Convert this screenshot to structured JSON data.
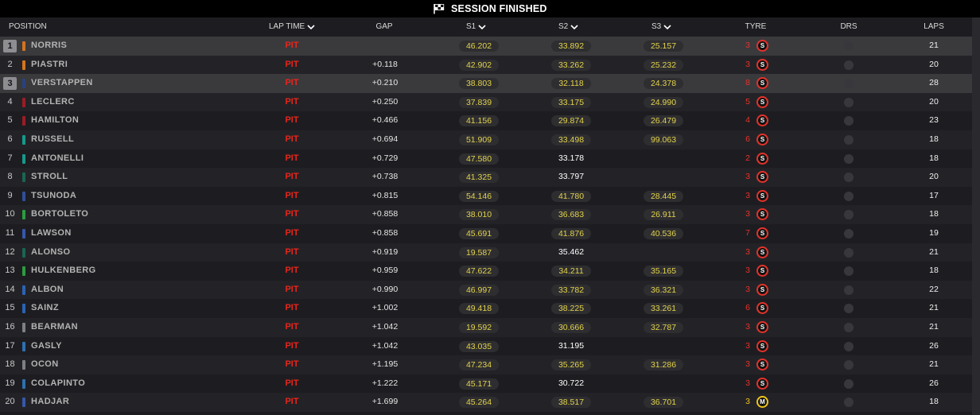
{
  "banner": {
    "title": "SESSION FINISHED",
    "icon": "checkered-flag-icon"
  },
  "columns": {
    "position": "POSITION",
    "lap_time": "LAP TIME",
    "gap": "GAP",
    "s1": "S1",
    "s2": "S2",
    "s3": "S3",
    "tyre": "TYRE",
    "drs": "DRS",
    "laps": "LAPS"
  },
  "colors": {
    "pit": "#e8251b",
    "sector_yellow": "#e3d24a",
    "sector_white": "#ffffff",
    "soft": "#e5322a",
    "medium": "#f0c419",
    "drs_off": "#38383c"
  },
  "rows": [
    {
      "position": "1",
      "driver": "NORRIS",
      "team_color": "#d4741f",
      "selected": true,
      "lap_time": "PIT",
      "gap": "",
      "s1": {
        "time": "46.202",
        "color": "#e3d24a"
      },
      "s2": {
        "time": "33.892",
        "color": "#e3d24a"
      },
      "s3": {
        "time": "25.157",
        "color": "#e3d24a"
      },
      "tyre": {
        "age": "3",
        "compound": "S",
        "color": "#e5322a"
      },
      "drs_open": false,
      "laps": "21"
    },
    {
      "position": "2",
      "driver": "PIASTRI",
      "team_color": "#d4741f",
      "selected": false,
      "lap_time": "PIT",
      "gap": "+0.118",
      "s1": {
        "time": "42.902",
        "color": "#e3d24a"
      },
      "s2": {
        "time": "33.262",
        "color": "#e3d24a"
      },
      "s3": {
        "time": "25.232",
        "color": "#e3d24a"
      },
      "tyre": {
        "age": "3",
        "compound": "S",
        "color": "#e5322a"
      },
      "drs_open": false,
      "laps": "20"
    },
    {
      "position": "3",
      "driver": "VERSTAPPEN",
      "team_color": "#28427f",
      "selected": true,
      "lap_time": "PIT",
      "gap": "+0.210",
      "s1": {
        "time": "38.803",
        "color": "#e3d24a"
      },
      "s2": {
        "time": "32.118",
        "color": "#e3d24a"
      },
      "s3": {
        "time": "24.378",
        "color": "#e3d24a"
      },
      "tyre": {
        "age": "8",
        "compound": "S",
        "color": "#e5322a"
      },
      "drs_open": false,
      "laps": "28"
    },
    {
      "position": "4",
      "driver": "LECLERC",
      "team_color": "#9b1c26",
      "selected": false,
      "lap_time": "PIT",
      "gap": "+0.250",
      "s1": {
        "time": "37.839",
        "color": "#e3d24a"
      },
      "s2": {
        "time": "33.175",
        "color": "#e3d24a"
      },
      "s3": {
        "time": "24.990",
        "color": "#e3d24a"
      },
      "tyre": {
        "age": "5",
        "compound": "S",
        "color": "#e5322a"
      },
      "drs_open": false,
      "laps": "20"
    },
    {
      "position": "5",
      "driver": "HAMILTON",
      "team_color": "#9b1c26",
      "selected": false,
      "lap_time": "PIT",
      "gap": "+0.466",
      "s1": {
        "time": "41.156",
        "color": "#e3d24a"
      },
      "s2": {
        "time": "29.874",
        "color": "#e3d24a"
      },
      "s3": {
        "time": "26.479",
        "color": "#e3d24a"
      },
      "tyre": {
        "age": "4",
        "compound": "S",
        "color": "#e5322a"
      },
      "drs_open": false,
      "laps": "23"
    },
    {
      "position": "6",
      "driver": "RUSSELL",
      "team_color": "#17998a",
      "selected": false,
      "lap_time": "PIT",
      "gap": "+0.694",
      "s1": {
        "time": "51.909",
        "color": "#e3d24a"
      },
      "s2": {
        "time": "33.498",
        "color": "#e3d24a"
      },
      "s3": {
        "time": "99.063",
        "color": "#e3d24a"
      },
      "tyre": {
        "age": "6",
        "compound": "S",
        "color": "#e5322a"
      },
      "drs_open": false,
      "laps": "18"
    },
    {
      "position": "7",
      "driver": "ANTONELLI",
      "team_color": "#17998a",
      "selected": false,
      "lap_time": "PIT",
      "gap": "+0.729",
      "s1": {
        "time": "47.580",
        "color": "#e3d24a"
      },
      "s2": {
        "time": "33.178",
        "color": "#ffffff",
        "pill": false
      },
      "s3": null,
      "tyre": {
        "age": "2",
        "compound": "S",
        "color": "#e5322a"
      },
      "drs_open": false,
      "laps": "18"
    },
    {
      "position": "8",
      "driver": "STROLL",
      "team_color": "#1b6452",
      "selected": false,
      "lap_time": "PIT",
      "gap": "+0.738",
      "s1": {
        "time": "41.325",
        "color": "#e3d24a"
      },
      "s2": {
        "time": "33.797",
        "color": "#ffffff",
        "pill": false
      },
      "s3": null,
      "tyre": {
        "age": "3",
        "compound": "S",
        "color": "#e5322a"
      },
      "drs_open": false,
      "laps": "20"
    },
    {
      "position": "9",
      "driver": "TSUNODA",
      "team_color": "#2f4f9a",
      "selected": false,
      "lap_time": "PIT",
      "gap": "+0.815",
      "s1": {
        "time": "54.146",
        "color": "#e3d24a"
      },
      "s2": {
        "time": "41.780",
        "color": "#e3d24a"
      },
      "s3": {
        "time": "28.445",
        "color": "#e3d24a"
      },
      "tyre": {
        "age": "3",
        "compound": "S",
        "color": "#e5322a"
      },
      "drs_open": false,
      "laps": "17"
    },
    {
      "position": "10",
      "driver": "BORTOLETO",
      "team_color": "#2c9c3f",
      "selected": false,
      "lap_time": "PIT",
      "gap": "+0.858",
      "s1": {
        "time": "38.010",
        "color": "#e3d24a"
      },
      "s2": {
        "time": "36.683",
        "color": "#e3d24a"
      },
      "s3": {
        "time": "26.911",
        "color": "#e3d24a"
      },
      "tyre": {
        "age": "3",
        "compound": "S",
        "color": "#e5322a"
      },
      "drs_open": false,
      "laps": "18"
    },
    {
      "position": "11",
      "driver": "LAWSON",
      "team_color": "#3658a8",
      "selected": false,
      "lap_time": "PIT",
      "gap": "+0.858",
      "s1": {
        "time": "45.691",
        "color": "#e3d24a"
      },
      "s2": {
        "time": "41.876",
        "color": "#e3d24a"
      },
      "s3": {
        "time": "40.536",
        "color": "#e3d24a"
      },
      "tyre": {
        "age": "7",
        "compound": "S",
        "color": "#e5322a"
      },
      "drs_open": false,
      "laps": "19"
    },
    {
      "position": "12",
      "driver": "ALONSO",
      "team_color": "#1b6452",
      "selected": false,
      "lap_time": "PIT",
      "gap": "+0.919",
      "s1": {
        "time": "19.587",
        "color": "#e3d24a"
      },
      "s2": {
        "time": "35.462",
        "color": "#ffffff",
        "pill": false
      },
      "s3": null,
      "tyre": {
        "age": "3",
        "compound": "S",
        "color": "#e5322a"
      },
      "drs_open": false,
      "laps": "21"
    },
    {
      "position": "13",
      "driver": "HULKENBERG",
      "team_color": "#2c9c3f",
      "selected": false,
      "lap_time": "PIT",
      "gap": "+0.959",
      "s1": {
        "time": "47.622",
        "color": "#e3d24a"
      },
      "s2": {
        "time": "34.211",
        "color": "#e3d24a"
      },
      "s3": {
        "time": "35.165",
        "color": "#e3d24a"
      },
      "tyre": {
        "age": "3",
        "compound": "S",
        "color": "#e5322a"
      },
      "drs_open": false,
      "laps": "18"
    },
    {
      "position": "14",
      "driver": "ALBON",
      "team_color": "#2b63b5",
      "selected": false,
      "lap_time": "PIT",
      "gap": "+0.990",
      "s1": {
        "time": "46.997",
        "color": "#e3d24a"
      },
      "s2": {
        "time": "33.782",
        "color": "#e3d24a"
      },
      "s3": {
        "time": "36.321",
        "color": "#e3d24a"
      },
      "tyre": {
        "age": "3",
        "compound": "S",
        "color": "#e5322a"
      },
      "drs_open": false,
      "laps": "22"
    },
    {
      "position": "15",
      "driver": "SAINZ",
      "team_color": "#2b63b5",
      "selected": false,
      "lap_time": "PIT",
      "gap": "+1.002",
      "s1": {
        "time": "49.418",
        "color": "#e3d24a"
      },
      "s2": {
        "time": "38.225",
        "color": "#e3d24a"
      },
      "s3": {
        "time": "33.261",
        "color": "#e3d24a"
      },
      "tyre": {
        "age": "6",
        "compound": "S",
        "color": "#e5322a"
      },
      "drs_open": false,
      "laps": "21"
    },
    {
      "position": "16",
      "driver": "BEARMAN",
      "team_color": "#7d8084",
      "selected": false,
      "lap_time": "PIT",
      "gap": "+1.042",
      "s1": {
        "time": "19.592",
        "color": "#e3d24a"
      },
      "s2": {
        "time": "30.666",
        "color": "#e3d24a"
      },
      "s3": {
        "time": "32.787",
        "color": "#e3d24a"
      },
      "tyre": {
        "age": "3",
        "compound": "S",
        "color": "#e5322a"
      },
      "drs_open": false,
      "laps": "21"
    },
    {
      "position": "17",
      "driver": "GASLY",
      "team_color": "#2f6fb0",
      "selected": false,
      "lap_time": "PIT",
      "gap": "+1.042",
      "s1": {
        "time": "43.035",
        "color": "#e3d24a"
      },
      "s2": {
        "time": "31.195",
        "color": "#ffffff",
        "pill": false
      },
      "s3": null,
      "tyre": {
        "age": "3",
        "compound": "S",
        "color": "#e5322a"
      },
      "drs_open": false,
      "laps": "26"
    },
    {
      "position": "18",
      "driver": "OCON",
      "team_color": "#7d8084",
      "selected": false,
      "lap_time": "PIT",
      "gap": "+1.195",
      "s1": {
        "time": "47.234",
        "color": "#e3d24a"
      },
      "s2": {
        "time": "35.265",
        "color": "#e3d24a"
      },
      "s3": {
        "time": "31.286",
        "color": "#e3d24a"
      },
      "tyre": {
        "age": "3",
        "compound": "S",
        "color": "#e5322a"
      },
      "drs_open": false,
      "laps": "21"
    },
    {
      "position": "19",
      "driver": "COLAPINTO",
      "team_color": "#2f6fb0",
      "selected": false,
      "lap_time": "PIT",
      "gap": "+1.222",
      "s1": {
        "time": "45.171",
        "color": "#e3d24a"
      },
      "s2": {
        "time": "30.722",
        "color": "#ffffff",
        "pill": false
      },
      "s3": null,
      "tyre": {
        "age": "3",
        "compound": "S",
        "color": "#e5322a"
      },
      "drs_open": false,
      "laps": "26"
    },
    {
      "position": "20",
      "driver": "HADJAR",
      "team_color": "#3658a8",
      "selected": false,
      "lap_time": "PIT",
      "gap": "+1.699",
      "s1": {
        "time": "45.264",
        "color": "#e3d24a"
      },
      "s2": {
        "time": "38.517",
        "color": "#e3d24a"
      },
      "s3": {
        "time": "36.701",
        "color": "#e3d24a"
      },
      "tyre": {
        "age": "3",
        "compound": "M",
        "color": "#f0c419"
      },
      "drs_open": false,
      "laps": "18"
    }
  ]
}
